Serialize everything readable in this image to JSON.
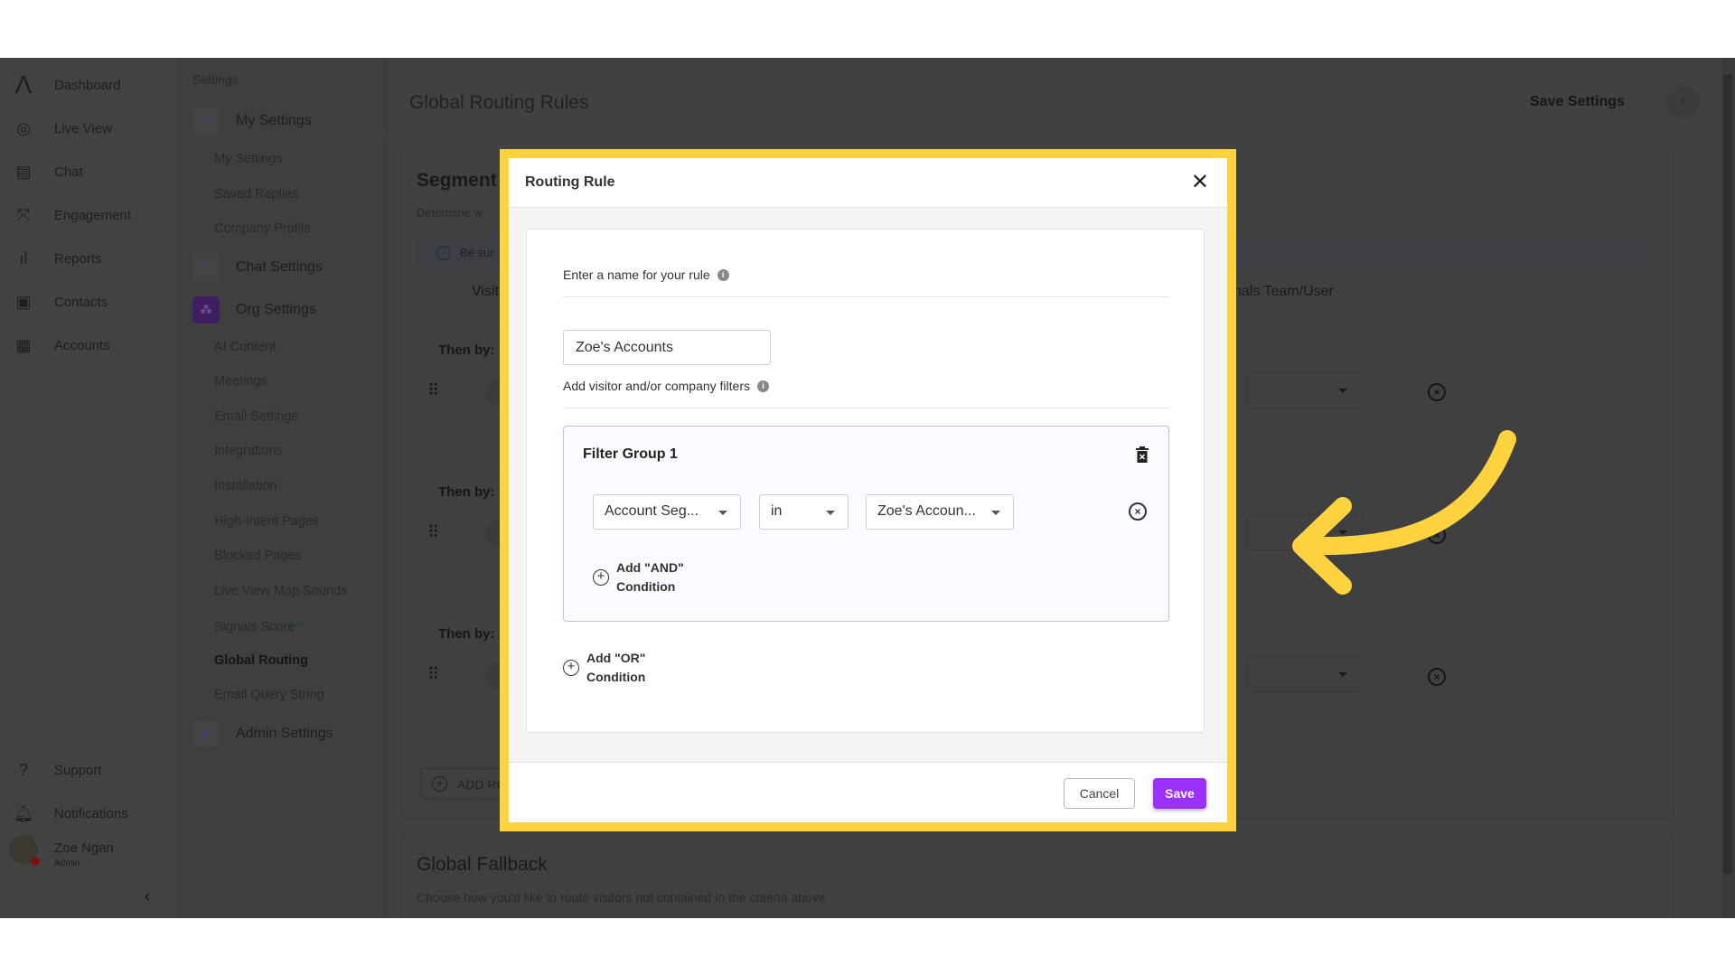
{
  "nav": {
    "items": [
      {
        "label": "Dashboard",
        "icon": "logo-icon"
      },
      {
        "label": "Live View",
        "icon": "globe-search-icon"
      },
      {
        "label": "Chat",
        "icon": "chat-icon"
      },
      {
        "label": "Engagement",
        "icon": "engagement-icon"
      },
      {
        "label": "Reports",
        "icon": "bar-chart-icon"
      },
      {
        "label": "Contacts",
        "icon": "contacts-icon"
      },
      {
        "label": "Accounts",
        "icon": "building-icon"
      }
    ],
    "support": "Support",
    "notifications": "Notifications",
    "user": {
      "name": "Zoe Ngan",
      "role": "Admin"
    }
  },
  "settings": {
    "heading": "Settings",
    "my_settings": "My Settings",
    "my_items": [
      "My Settings",
      "Saved Replies",
      "Company Profile"
    ],
    "chat_settings": "Chat Settings",
    "org_settings": "Org Settings",
    "org_items": [
      "AI Content",
      "Meetings",
      "Email Settings",
      "Integrations",
      "Installation",
      "High-Intent Pages",
      "Blocked Pages",
      "Live View Map Sounds",
      "Signals Score",
      "Global Routing",
      "Email Query String"
    ],
    "signals_badge": "✦",
    "admin_settings": "Admin Settings",
    "active": "Global Routing"
  },
  "main": {
    "title": "Global Routing Rules",
    "save_settings": "Save Settings",
    "segment_title": "Segment",
    "segment_desc": "Determine w",
    "banner": "Be sur",
    "col_visit": "Visit",
    "col_team": "nals Team/User",
    "then_by": "Then by:",
    "add_rule": "ADD RO",
    "fallback_title": "Global Fallback",
    "fallback_desc": "Choose how you'd like to route visitors not contained in the criteria above"
  },
  "modal": {
    "title": "Routing Rule",
    "name_label": "Enter a name for your rule",
    "name_value": "Zoe's Accounts",
    "filters_label": "Add visitor and/or company filters",
    "filter_group": {
      "title": "Filter Group 1",
      "field": "Account Seg...",
      "operator": "in",
      "value": "Zoe's Accoun..."
    },
    "add_and": "Add \"AND\" Condition",
    "add_or": "Add \"OR\" Condition",
    "cancel": "Cancel",
    "save": "Save"
  },
  "colors": {
    "highlight": "#ffd23f",
    "accent": "#9b30ff",
    "filter_border": "#cbb8ee"
  }
}
